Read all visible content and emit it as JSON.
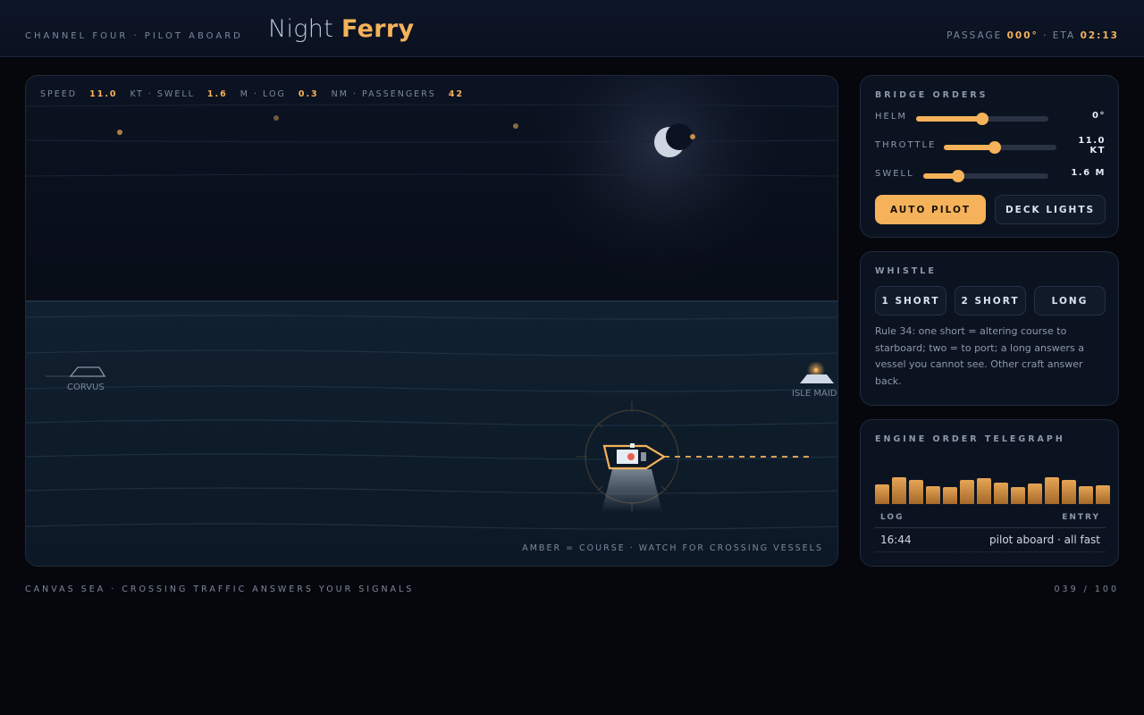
{
  "header": {
    "eyebrow": "CHANNEL FOUR · PILOT ABOARD",
    "title_main": "Night",
    "title_accent": "Ferry",
    "passage_label": "PASSAGE",
    "passage_value": "000°",
    "eta_label": "· ETA",
    "eta_value": "02:13"
  },
  "hud": {
    "speed_label": "SPEED",
    "speed_value": "11.0",
    "swell_label": "KT · SWELL",
    "swell_value": "1.6",
    "log_label": "M · LOG",
    "log_value": "0.3",
    "passengers_label": "NM · PASSENGERS",
    "passengers_value": "42",
    "legend": "AMBER = COURSE · WATCH FOR CROSSING VESSELS"
  },
  "vessels": [
    {
      "name": "CORVUS"
    },
    {
      "name": "ISLE MAID"
    }
  ],
  "bridge_orders": {
    "title": "BRIDGE ORDERS",
    "helm": {
      "label": "HELM",
      "value": "0°",
      "level": 0.5
    },
    "throttle": {
      "label": "THROTTLE",
      "value": "11.0 KT",
      "level": 0.45
    },
    "swell": {
      "label": "SWELL",
      "value": "1.6 M",
      "level": 0.28
    },
    "auto_pilot": "AUTO PILOT",
    "deck_lights": "DECK LIGHTS"
  },
  "whistle": {
    "title": "WHISTLE",
    "one_short": "1 SHORT",
    "two_short": "2 SHORT",
    "long": "LONG",
    "rule": "Rule 34: one short = altering course to starboard; two = to port; a long answers a vessel you cannot see. Other craft answer back."
  },
  "telegraph": {
    "title": "ENGINE ORDER TELEGRAPH",
    "bar_levels": [
      0.55,
      0.75,
      0.68,
      0.5,
      0.48,
      0.68,
      0.72,
      0.6,
      0.48,
      0.58,
      0.75,
      0.68,
      0.5,
      0.53
    ],
    "log_header": "LOG",
    "entry_header": "ENTRY",
    "log_time": "16:44",
    "log_entry": "pilot aboard · all fast"
  },
  "footer": {
    "left": "CANVAS SEA · CROSSING TRAFFIC ANSWERS YOUR SIGNALS",
    "right": "039 / 100"
  },
  "colors": {
    "accent": "#f5b25a",
    "background": "#05070c",
    "panel": "#0c1320",
    "sea": "#0f1c2b"
  }
}
